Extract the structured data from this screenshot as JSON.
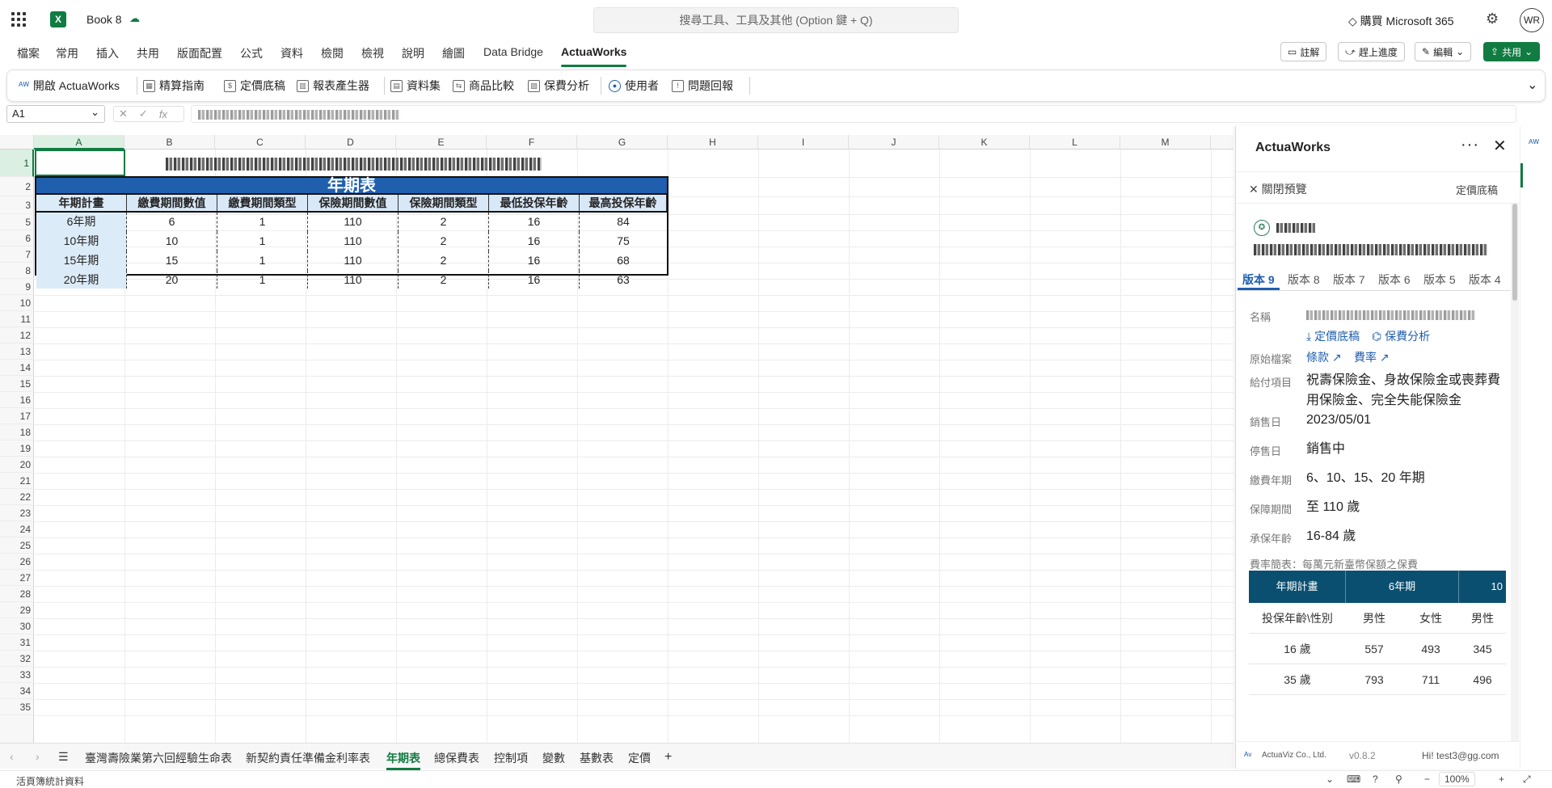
{
  "app": {
    "book_name": "Book 8",
    "search_placeholder": "搜尋工具、工具及其他 (Option 鍵 + Q)",
    "buy_label": "購買 Microsoft 365",
    "avatar_initials": "WR",
    "accent_color": "#107c41"
  },
  "ribbon_tabs": [
    "檔案",
    "常用",
    "插入",
    "共用",
    "版面配置",
    "公式",
    "資料",
    "檢閱",
    "檢視",
    "說明",
    "繪圖",
    "Data Bridge",
    "ActuaWorks"
  ],
  "top_buttons": {
    "comment": "註解",
    "catch_up": "趕上進度",
    "edit": "編輯",
    "share": "共用"
  },
  "ribbon": {
    "items": [
      {
        "label": "開啟 ActuaWorks",
        "icon": "actuaworks-logo-icon"
      },
      {
        "label": "精算指南",
        "icon": "calculator-icon"
      },
      {
        "label": "定價底稿",
        "icon": "document-icon"
      },
      {
        "label": "報表產生器",
        "icon": "chart-icon"
      },
      {
        "label": "資料集",
        "icon": "table-icon"
      },
      {
        "label": "商品比較",
        "icon": "compare-icon"
      },
      {
        "label": "保費分析",
        "icon": "analysis-icon"
      },
      {
        "label": "使用者",
        "icon": "user-icon"
      },
      {
        "label": "問題回報",
        "icon": "feedback-icon"
      }
    ]
  },
  "formula_bar": {
    "name_box": "A1",
    "fx": "fx"
  },
  "columns": [
    "A",
    "B",
    "C",
    "D",
    "E",
    "F",
    "G",
    "H",
    "I",
    "J",
    "K",
    "L",
    "M"
  ],
  "rows": [
    "1",
    "2",
    "3",
    "5",
    "6",
    "7",
    "8",
    "9",
    "10",
    "11",
    "12",
    "13",
    "14",
    "15",
    "16",
    "17",
    "18",
    "19",
    "20",
    "21",
    "22",
    "23",
    "24",
    "25",
    "26",
    "27",
    "28",
    "29",
    "30",
    "31",
    "32",
    "33",
    "34",
    "35"
  ],
  "sheet": {
    "banner": "年期表",
    "headers": [
      "年期計畫",
      "繳費期間數值",
      "繳費期間類型",
      "保險期間數值",
      "保險期間類型",
      "最低投保年齡",
      "最高投保年齡"
    ],
    "rows": [
      [
        "6年期",
        "6",
        "1",
        "110",
        "2",
        "16",
        "84"
      ],
      [
        "10年期",
        "10",
        "1",
        "110",
        "2",
        "16",
        "75"
      ],
      [
        "15年期",
        "15",
        "1",
        "110",
        "2",
        "16",
        "68"
      ],
      [
        "20年期",
        "20",
        "1",
        "110",
        "2",
        "16",
        "63"
      ]
    ]
  },
  "sheet_tabs": [
    "臺灣壽險業第六回經驗生命表",
    "新契約責任準備金利率表",
    "年期表",
    "總保費表",
    "控制項",
    "變數",
    "基數表",
    "定價"
  ],
  "active_sheet": "年期表",
  "status": {
    "left": "活頁簿統計資料",
    "zoom": "100%"
  },
  "pane": {
    "title": "ActuaWorks",
    "close_preview": "關閉預覽",
    "pricing_link": "定價底稿",
    "version_tabs": [
      "版本 9",
      "版本 8",
      "版本 7",
      "版本 6",
      "版本 5",
      "版本 4"
    ],
    "labels": {
      "name": "名稱",
      "source": "原始檔案",
      "benefits": "給付項目",
      "sale_date": "銷售日",
      "stop_date": "停售日",
      "pay_period": "繳費年期",
      "coverage": "保障期間",
      "age": "承保年齡",
      "rate_table": "費率簡表：每萬元新臺幣保額之保費"
    },
    "actions": {
      "pricing": "定價底稿",
      "premium": "保費分析"
    },
    "source_links": {
      "terms": "條款",
      "rates": "費率"
    },
    "values": {
      "benefits": "祝壽保險金、身故保險金或喪葬費用保險金、完全失能保險金",
      "sale_date": "2023/05/01",
      "stop_date": "銷售中",
      "pay_period": "6、10、15、20 年期",
      "coverage": "至 110 歲",
      "age": "16-84 歲"
    },
    "rate_table": {
      "head": [
        "年期計畫",
        "6年期",
        "10"
      ],
      "sub": [
        "投保年齡\\性別",
        "男性",
        "女性",
        "男性"
      ],
      "rows": [
        [
          "16 歲",
          "557",
          "493",
          "345"
        ],
        [
          "35 歲",
          "793",
          "711",
          "496"
        ]
      ]
    },
    "footer": {
      "company": "ActuaViz Co., Ltd.",
      "version": "v0.8.2",
      "greeting": "Hi! test3@gg.com"
    }
  }
}
